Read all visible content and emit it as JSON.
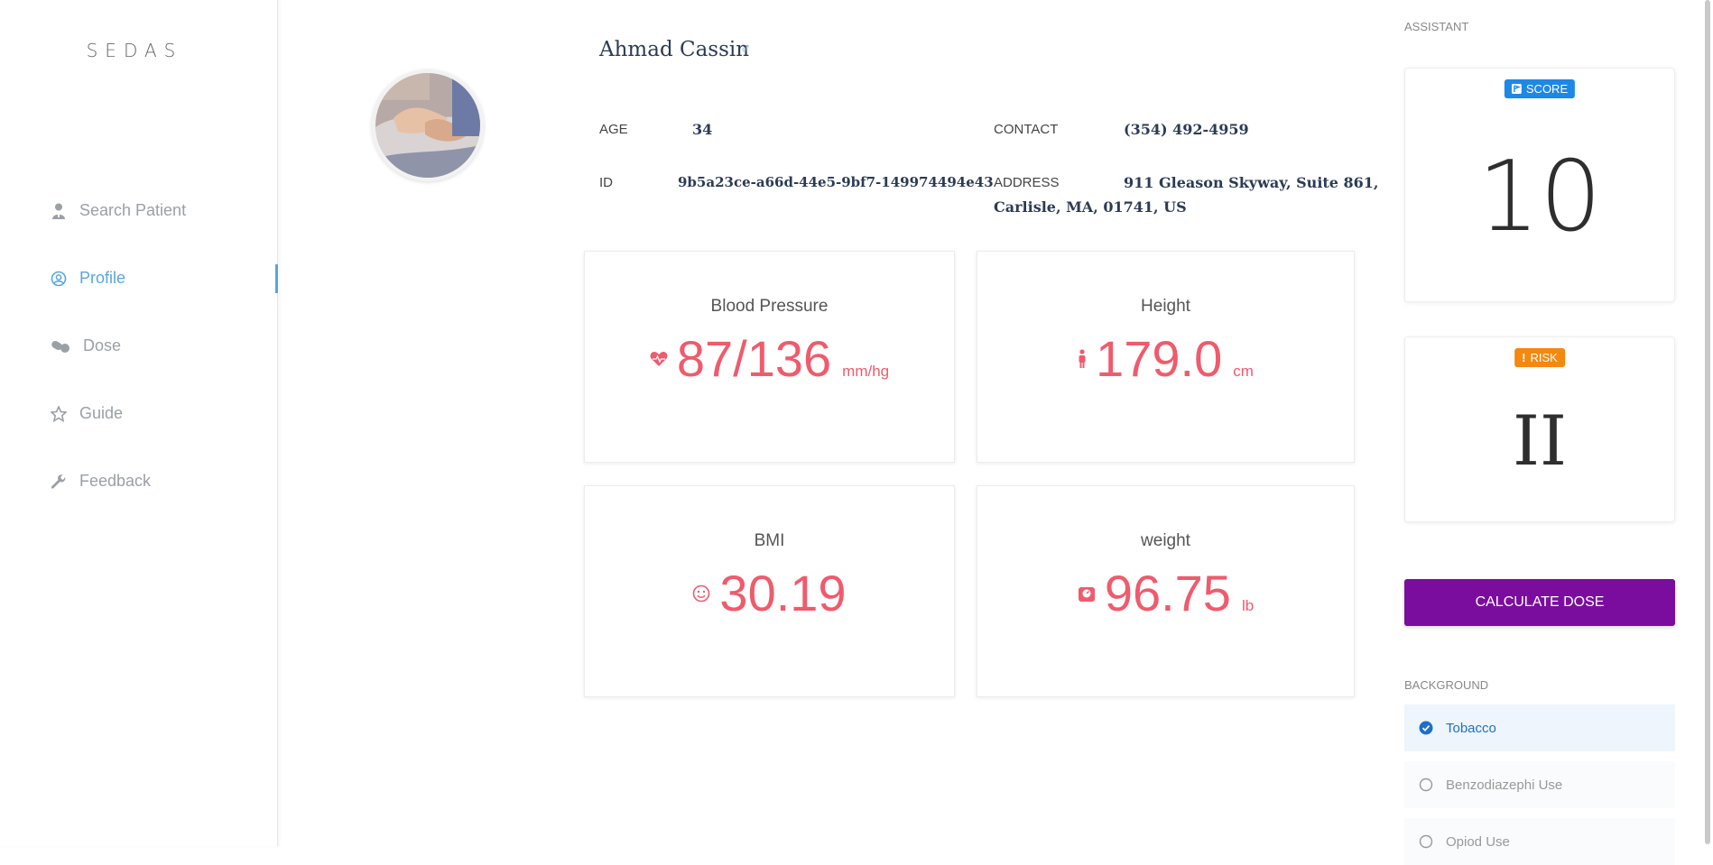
{
  "brand": "SEDAS",
  "nav": [
    {
      "label": "Search Patient",
      "icon": "doctor-icon"
    },
    {
      "label": "Profile",
      "icon": "user-circle-icon",
      "active": true
    },
    {
      "label": "Dose",
      "icon": "pills-icon"
    },
    {
      "label": "Guide",
      "icon": "star-icon"
    },
    {
      "label": "Feedback",
      "icon": "wrench-icon"
    }
  ],
  "patient": {
    "name": "Ahmad Cassin",
    "gender_symbol": "♂",
    "age_label": "AGE",
    "age": "34",
    "id_label": "ID",
    "id": "9b5a23ce-a66d-44e5-9bf7-149974494e43",
    "contact_label": "CONTACT",
    "contact": "(354) 492-4959",
    "address_label": "ADDRESS",
    "address_line1": "911 Gleason Skyway, Suite 861,",
    "address_line2": "Carlisle, MA, 01741, US"
  },
  "vitals": {
    "bp": {
      "title": "Blood Pressure",
      "value": "87/136",
      "unit": "mm/hg",
      "icon": "heartbeat-icon"
    },
    "height": {
      "title": "Height",
      "value": "179.0",
      "unit": "cm",
      "icon": "person-icon"
    },
    "bmi": {
      "title": "BMI",
      "value": "30.19",
      "unit": "",
      "icon": "smile-icon"
    },
    "weight": {
      "title": "weight",
      "value": "96.75",
      "unit": "lb",
      "icon": "scale-icon"
    }
  },
  "assistant": {
    "label": "ASSISTANT",
    "score_badge": "SCORE",
    "score": "10",
    "risk_badge": "RISK",
    "risk": "II",
    "calc_button": "CALCULATE DOSE",
    "background_label": "BACKGROUND",
    "background": [
      {
        "label": "Tobacco",
        "checked": true
      },
      {
        "label": "Benzodiazephi Use",
        "checked": false
      },
      {
        "label": "Opiod Use",
        "checked": false
      }
    ]
  },
  "colors": {
    "accent": "#5aa6dc",
    "vital_red": "#ef5b6d",
    "score_badge": "#1e88e5",
    "risk_badge": "#f5880e",
    "calc_button": "#7b0d9e"
  }
}
